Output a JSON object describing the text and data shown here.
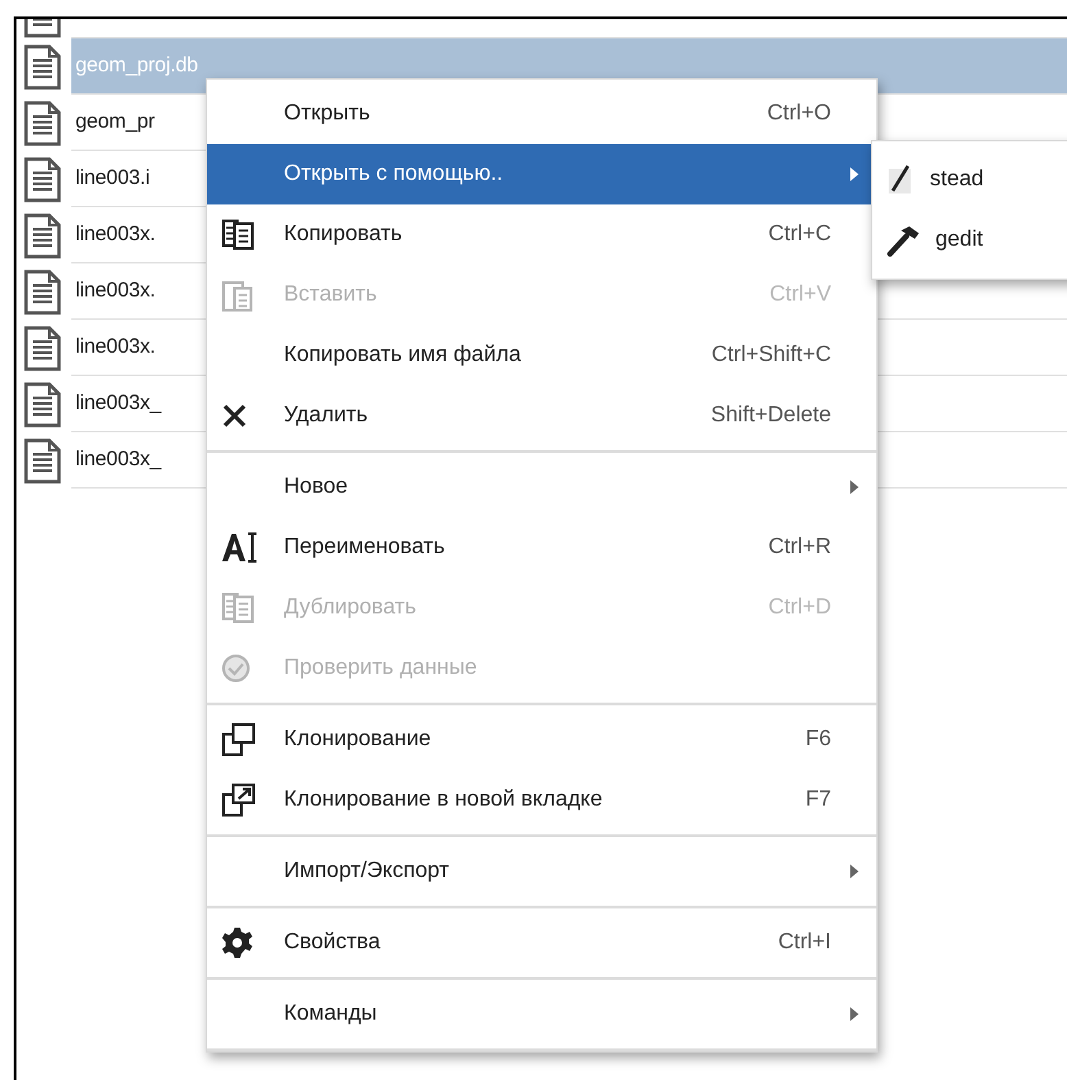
{
  "files": [
    {
      "name": "geom_proj.db",
      "selected": true
    },
    {
      "name": "geom_pr",
      "selected": false
    },
    {
      "name": "line003.i",
      "selected": false
    },
    {
      "name": "line003x.",
      "selected": false
    },
    {
      "name": "line003x.",
      "selected": false
    },
    {
      "name": "line003x.",
      "selected": false
    },
    {
      "name": "line003x_",
      "selected": false
    },
    {
      "name": "line003x_",
      "selected": false
    }
  ],
  "context_menu": {
    "sections": [
      [
        {
          "label": "Открыть",
          "shortcut": "Ctrl+O",
          "disabled": false,
          "submenu": false,
          "selected": false
        },
        {
          "label": "Открыть с помощью..",
          "disabled": false,
          "submenu": true,
          "selected": true
        },
        {
          "label": "Копировать",
          "shortcut": "Ctrl+C",
          "disabled": false,
          "submenu": false,
          "selected": false
        },
        {
          "label": "Вставить",
          "shortcut": "Ctrl+V",
          "disabled": true,
          "submenu": false,
          "selected": false
        },
        {
          "label": "Копировать имя файла",
          "shortcut": "Ctrl+Shift+C",
          "disabled": false,
          "submenu": false,
          "selected": false
        },
        {
          "label": "Удалить",
          "shortcut": "Shift+Delete",
          "disabled": false,
          "submenu": false,
          "selected": false
        }
      ],
      [
        {
          "label": "Новое",
          "disabled": false,
          "submenu": true,
          "selected": false
        },
        {
          "label": "Переименовать",
          "shortcut": "Ctrl+R",
          "disabled": false,
          "submenu": false,
          "selected": false
        },
        {
          "label": "Дублировать",
          "shortcut": "Ctrl+D",
          "disabled": true,
          "submenu": false,
          "selected": false
        },
        {
          "label": "Проверить данные",
          "disabled": true,
          "submenu": false,
          "selected": false
        }
      ],
      [
        {
          "label": "Клонирование",
          "shortcut": "F6",
          "disabled": false,
          "submenu": false,
          "selected": false
        },
        {
          "label": "Клонирование в новой вкладке",
          "shortcut": "F7",
          "disabled": false,
          "submenu": false,
          "selected": false
        }
      ],
      [
        {
          "label": "Импорт/Экспорт",
          "disabled": false,
          "submenu": true,
          "selected": false
        }
      ],
      [
        {
          "label": "Свойства",
          "shortcut": "Ctrl+I",
          "disabled": false,
          "submenu": false,
          "selected": false
        }
      ],
      [
        {
          "label": "Команды",
          "disabled": false,
          "submenu": true,
          "selected": false
        }
      ]
    ]
  },
  "submenu": [
    {
      "label": "stead"
    },
    {
      "label": "gedit"
    }
  ]
}
